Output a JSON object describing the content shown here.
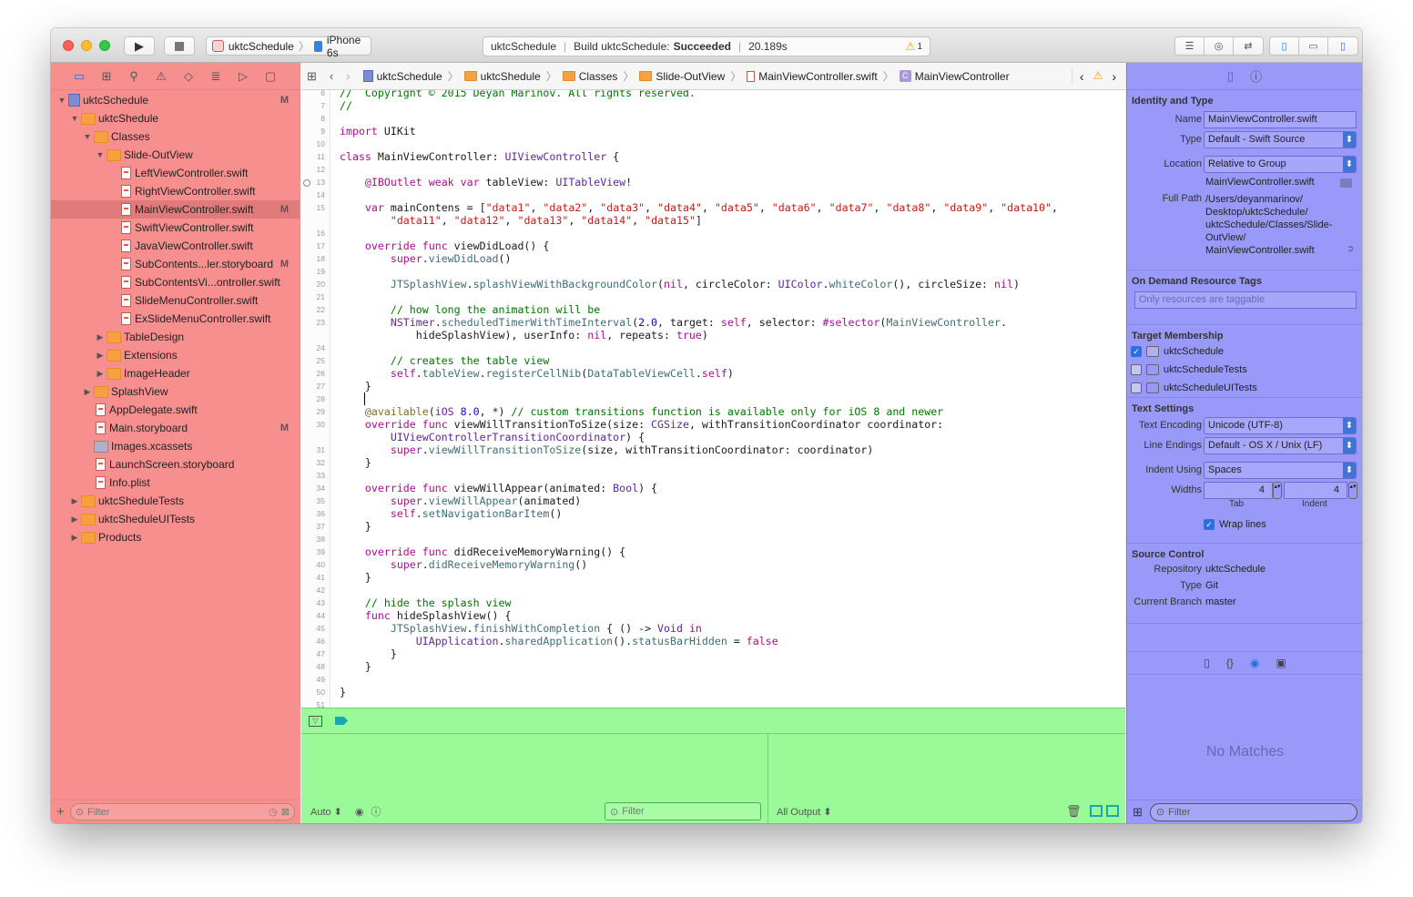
{
  "toolbar": {
    "scheme_project": "uktcSchedule",
    "scheme_device": "iPhone 6s",
    "activity_project": "uktcSchedule",
    "activity_build_prefix": "Build uktcSchedule:",
    "activity_build_status": "Succeeded",
    "activity_time": "20.189s",
    "warning_count": "1"
  },
  "navigator": {
    "filter_placeholder": "Filter",
    "tree": [
      {
        "label": "uktcSchedule",
        "depth": 0,
        "icon": "project-icon",
        "arrow": "▼",
        "mark": "M"
      },
      {
        "label": "uktcShedule",
        "depth": 1,
        "icon": "folder-icon",
        "arrow": "▼",
        "mark": ""
      },
      {
        "label": "Classes",
        "depth": 2,
        "icon": "folder-icon",
        "arrow": "▼",
        "mark": ""
      },
      {
        "label": "Slide-OutView",
        "depth": 3,
        "icon": "folder-icon",
        "arrow": "▼",
        "mark": ""
      },
      {
        "label": "LeftViewController.swift",
        "depth": 4,
        "icon": "swift-file-icon",
        "arrow": "",
        "mark": ""
      },
      {
        "label": "RightViewController.swift",
        "depth": 4,
        "icon": "swift-file-icon",
        "arrow": "",
        "mark": ""
      },
      {
        "label": "MainViewController.swift",
        "depth": 4,
        "icon": "swift-file-icon",
        "arrow": "",
        "mark": "M",
        "selected": true
      },
      {
        "label": "SwiftViewController.swift",
        "depth": 4,
        "icon": "swift-file-icon",
        "arrow": "",
        "mark": ""
      },
      {
        "label": "JavaViewController.swift",
        "depth": 4,
        "icon": "swift-file-icon",
        "arrow": "",
        "mark": ""
      },
      {
        "label": "SubContents...ler.storyboard",
        "depth": 4,
        "icon": "storyboard-file-icon",
        "arrow": "",
        "mark": "M"
      },
      {
        "label": "SubContentsVi...ontroller.swift",
        "depth": 4,
        "icon": "swift-file-icon",
        "arrow": "",
        "mark": ""
      },
      {
        "label": "SlideMenuController.swift",
        "depth": 4,
        "icon": "swift-file-icon",
        "arrow": "",
        "mark": ""
      },
      {
        "label": "ExSlideMenuController.swift",
        "depth": 4,
        "icon": "swift-file-icon",
        "arrow": "",
        "mark": ""
      },
      {
        "label": "TableDesign",
        "depth": 3,
        "icon": "folder-icon",
        "arrow": "▶",
        "mark": ""
      },
      {
        "label": "Extensions",
        "depth": 3,
        "icon": "folder-icon",
        "arrow": "▶",
        "mark": ""
      },
      {
        "label": "ImageHeader",
        "depth": 3,
        "icon": "folder-icon",
        "arrow": "▶",
        "mark": ""
      },
      {
        "label": "SplashView",
        "depth": 2,
        "icon": "folder-icon",
        "arrow": "▶",
        "mark": ""
      },
      {
        "label": "AppDelegate.swift",
        "depth": 2,
        "icon": "swift-file-icon",
        "arrow": "",
        "mark": ""
      },
      {
        "label": "Main.storyboard",
        "depth": 2,
        "icon": "storyboard-file-icon",
        "arrow": "",
        "mark": "M"
      },
      {
        "label": "Images.xcassets",
        "depth": 2,
        "icon": "assets-icon",
        "arrow": "",
        "mark": ""
      },
      {
        "label": "LaunchScreen.storyboard",
        "depth": 2,
        "icon": "storyboard-file-icon",
        "arrow": "",
        "mark": ""
      },
      {
        "label": "Info.plist",
        "depth": 2,
        "icon": "plist-file-icon",
        "arrow": "",
        "mark": ""
      },
      {
        "label": "uktcSheduleTests",
        "depth": 1,
        "icon": "folder-icon",
        "arrow": "▶",
        "mark": ""
      },
      {
        "label": "uktcSheduleUITests",
        "depth": 1,
        "icon": "folder-icon",
        "arrow": "▶",
        "mark": ""
      },
      {
        "label": "Products",
        "depth": 1,
        "icon": "folder-icon",
        "arrow": "▶",
        "mark": ""
      }
    ]
  },
  "jumpbar": {
    "crumbs": [
      "uktcSchedule",
      "uktcShedule",
      "Classes",
      "Slide-OutView",
      "MainViewController.swift",
      "MainViewController"
    ]
  },
  "editor": {
    "lines": [
      {
        "n": "6",
        "h": "<span class=\"cm\">//  Copyright © 2015 Deyan Marinov. All rights reserved.</span>"
      },
      {
        "n": "7",
        "h": "<span class=\"cm\">//</span>"
      },
      {
        "n": "8",
        "h": ""
      },
      {
        "n": "9",
        "h": "<span class=\"kw\">import</span> UIKit"
      },
      {
        "n": "10",
        "h": ""
      },
      {
        "n": "11",
        "h": "<span class=\"kw\">class</span> MainViewController: <span class=\"ty\">UIViewController</span> {"
      },
      {
        "n": "12",
        "h": ""
      },
      {
        "n": "13",
        "h": "    <span class=\"kw\">@IBOutlet</span> <span class=\"kw\">weak</span> <span class=\"kw\">var</span> tableView: <span class=\"ty\">UITableView</span>!"
      },
      {
        "n": "14",
        "h": ""
      },
      {
        "n": "15",
        "h": "    <span class=\"kw\">var</span> mainContens = [<span class=\"str\">\"data1\"</span>, <span class=\"str\">\"data2\"</span>, <span class=\"str\">\"data3\"</span>, <span class=\"str\">\"data4\"</span>, <span class=\"str\">\"data5\"</span>, <span class=\"str\">\"data6\"</span>, <span class=\"str\">\"data7\"</span>, <span class=\"str\">\"data8\"</span>, <span class=\"str\">\"data9\"</span>, <span class=\"str\">\"data10\"</span>,"
      },
      {
        "n": "",
        "h": "        <span class=\"str\">\"data11\"</span>, <span class=\"str\">\"data12\"</span>, <span class=\"str\">\"data13\"</span>, <span class=\"str\">\"data14\"</span>, <span class=\"str\">\"data15\"</span>]"
      },
      {
        "n": "16",
        "h": ""
      },
      {
        "n": "17",
        "h": "    <span class=\"kw\">override</span> <span class=\"kw\">func</span> viewDidLoad() {"
      },
      {
        "n": "18",
        "h": "        <span class=\"kw\">super</span>.<span class=\"fnp\">viewDidLoad</span>()"
      },
      {
        "n": "19",
        "h": ""
      },
      {
        "n": "20",
        "h": "        <span class=\"fnp\">JTSplashView</span>.<span class=\"fnp\">splashViewWithBackgroundColor</span>(<span class=\"kw\">nil</span>, circleColor: <span class=\"ty\">UIColor</span>.<span class=\"fnp\">whiteColor</span>(), circleSize: <span class=\"kw\">nil</span>)"
      },
      {
        "n": "21",
        "h": ""
      },
      {
        "n": "22",
        "h": "        <span class=\"cm\">// how long the animation will be</span>"
      },
      {
        "n": "23",
        "h": "        <span class=\"ty\">NSTimer</span>.<span class=\"fnp\">scheduledTimerWithTimeInterval</span>(<span class=\"num\">2.0</span>, target: <span class=\"kw\">self</span>, selector: <span class=\"kw\">#selector</span>(<span class=\"fnp\">MainViewController</span>."
      },
      {
        "n": "",
        "h": "            hideSplashView), userInfo: <span class=\"kw\">nil</span>, repeats: <span class=\"kw\">true</span>)"
      },
      {
        "n": "24",
        "h": ""
      },
      {
        "n": "25",
        "h": "        <span class=\"cm\">// creates the table view</span>"
      },
      {
        "n": "26",
        "h": "        <span class=\"kw\">self</span>.<span class=\"fnp\">tableView</span>.<span class=\"fnp\">registerCellNib</span>(<span class=\"fnp\">DataTableViewCell</span>.<span class=\"kw\">self</span>)"
      },
      {
        "n": "27",
        "h": "    }"
      },
      {
        "n": "28",
        "h": ""
      },
      {
        "n": "29",
        "h": "    <span class=\"at\">@available</span>(<span class=\"ty\">iOS</span> <span class=\"num\">8.0</span>, *) <span class=\"cm\">// custom transitions function is available only for iOS 8 and newer</span>"
      },
      {
        "n": "30",
        "h": "    <span class=\"kw\">override</span> <span class=\"kw\">func</span> viewWillTransitionToSize(size: <span class=\"ty\">CGSize</span>, withTransitionCoordinator coordinator:"
      },
      {
        "n": "",
        "h": "        <span class=\"ty\">UIViewControllerTransitionCoordinator</span>) {"
      },
      {
        "n": "31",
        "h": "        <span class=\"kw\">super</span>.<span class=\"fnp\">viewWillTransitionToSize</span>(size, withTransitionCoordinator: coordinator)"
      },
      {
        "n": "32",
        "h": "    }"
      },
      {
        "n": "33",
        "h": ""
      },
      {
        "n": "34",
        "h": "    <span class=\"kw\">override</span> <span class=\"kw\">func</span> viewWillAppear(animated: <span class=\"ty\">Bool</span>) {"
      },
      {
        "n": "35",
        "h": "        <span class=\"kw\">super</span>.<span class=\"fnp\">viewWillAppear</span>(animated)"
      },
      {
        "n": "36",
        "h": "        <span class=\"kw\">self</span>.<span class=\"fnp\">setNavigationBarItem</span>()"
      },
      {
        "n": "37",
        "h": "    }"
      },
      {
        "n": "38",
        "h": ""
      },
      {
        "n": "39",
        "h": "    <span class=\"kw\">override</span> <span class=\"kw\">func</span> didReceiveMemoryWarning() {"
      },
      {
        "n": "40",
        "h": "        <span class=\"kw\">super</span>.<span class=\"fnp\">didReceiveMemoryWarning</span>()"
      },
      {
        "n": "41",
        "h": "    }"
      },
      {
        "n": "42",
        "h": ""
      },
      {
        "n": "43",
        "h": "    <span class=\"cm\">// hide the splash view</span>"
      },
      {
        "n": "44",
        "h": "    <span class=\"kw\">func</span> hideSplashView() {"
      },
      {
        "n": "45",
        "h": "        <span class=\"fnp\">JTSplashView</span>.<span class=\"fnp\">finishWithCompletion</span> { () -> <span class=\"ty\">Void</span> <span class=\"kw\">in</span>"
      },
      {
        "n": "46",
        "h": "            <span class=\"ty\">UIApplication</span>.<span class=\"fnp\">sharedApplication</span>().<span class=\"fnp\">statusBarHidden</span> = <span class=\"kw\">false</span>"
      },
      {
        "n": "47",
        "h": "        }"
      },
      {
        "n": "48",
        "h": "    }"
      },
      {
        "n": "49",
        "h": ""
      },
      {
        "n": "50",
        "h": "}"
      },
      {
        "n": "51",
        "h": ""
      }
    ]
  },
  "debug": {
    "auto_label": "Auto ⬍",
    "filter_placeholder": "Filter",
    "output_label": "All Output ⬍"
  },
  "inspector": {
    "identity_title": "Identity and Type",
    "name_label": "Name",
    "name_value": "MainViewController.swift",
    "type_label": "Type",
    "type_value": "Default - Swift Source",
    "location_label": "Location",
    "location_value": "Relative to Group",
    "location_file": "MainViewController.swift",
    "fullpath_label": "Full Path",
    "fullpath_lines": [
      "/Users/deyanmarinov/",
      "Desktop/uktcSchedule/",
      "uktcSchedule/Classes/Slide-",
      "OutView/",
      "MainViewController.swift"
    ],
    "odr_title": "On Demand Resource Tags",
    "odr_placeholder": "Only resources are taggable",
    "target_title": "Target Membership",
    "targets": [
      {
        "label": "uktcSchedule",
        "checked": true
      },
      {
        "label": "uktcScheduleTests",
        "checked": false
      },
      {
        "label": "uktcScheduleUITests",
        "checked": false
      }
    ],
    "text_title": "Text Settings",
    "encoding_label": "Text Encoding",
    "encoding_value": "Unicode (UTF-8)",
    "endings_label": "Line Endings",
    "endings_value": "Default - OS X / Unix (LF)",
    "indent_label": "Indent Using",
    "indent_value": "Spaces",
    "widths_label": "Widths",
    "tab_value": "4",
    "indent_width_value": "4",
    "tab_caption": "Tab",
    "indent_caption": "Indent",
    "wrap_label": "Wrap lines",
    "sc_title": "Source Control",
    "repo_label": "Repository",
    "repo_value": "uktcSchedule",
    "sctype_label": "Type",
    "sctype_value": "Git",
    "branch_label": "Current Branch",
    "branch_value": "master",
    "no_matches": "No Matches",
    "filter_placeholder": "Filter"
  }
}
